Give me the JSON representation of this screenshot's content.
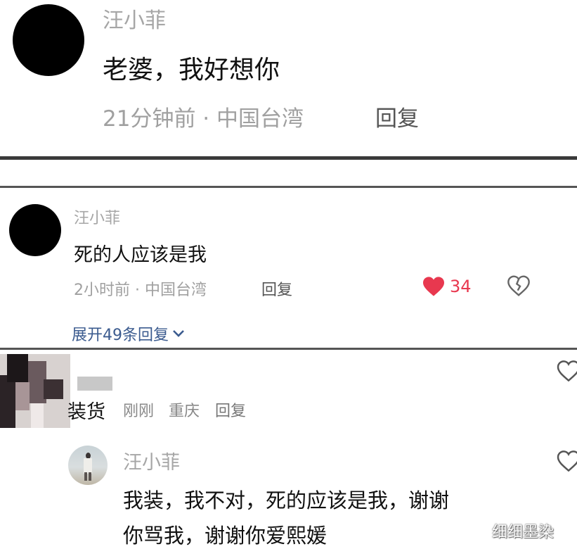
{
  "comment1": {
    "username": "汪小菲",
    "text": "老婆，我好想你",
    "meta": "21分钟前 · 中国台湾",
    "reply_label": "回复"
  },
  "comment2": {
    "username": "汪小菲",
    "text": "死的人应该是我",
    "meta": "2小时前 · 中国台湾",
    "reply_label": "回复",
    "like_count": "34",
    "expand_replies": "展开49条回复"
  },
  "comment3": {
    "text": "装货",
    "time": "刚刚",
    "location": "重庆",
    "reply_label": "回复"
  },
  "reply1": {
    "username": "汪小菲",
    "text_line1": "我装，我不对，死的应该是我，谢谢",
    "text_line2": "你骂我，谢谢你爱熙媛"
  },
  "watermark": "细细墨染",
  "colors": {
    "like_red": "#e8384f",
    "link_blue": "#3b5b8f",
    "meta_gray": "#a0a0a0"
  },
  "icons": [
    "heart-filled-icon",
    "broken-heart-icon",
    "heart-outline-icon",
    "chevron-down-icon"
  ]
}
